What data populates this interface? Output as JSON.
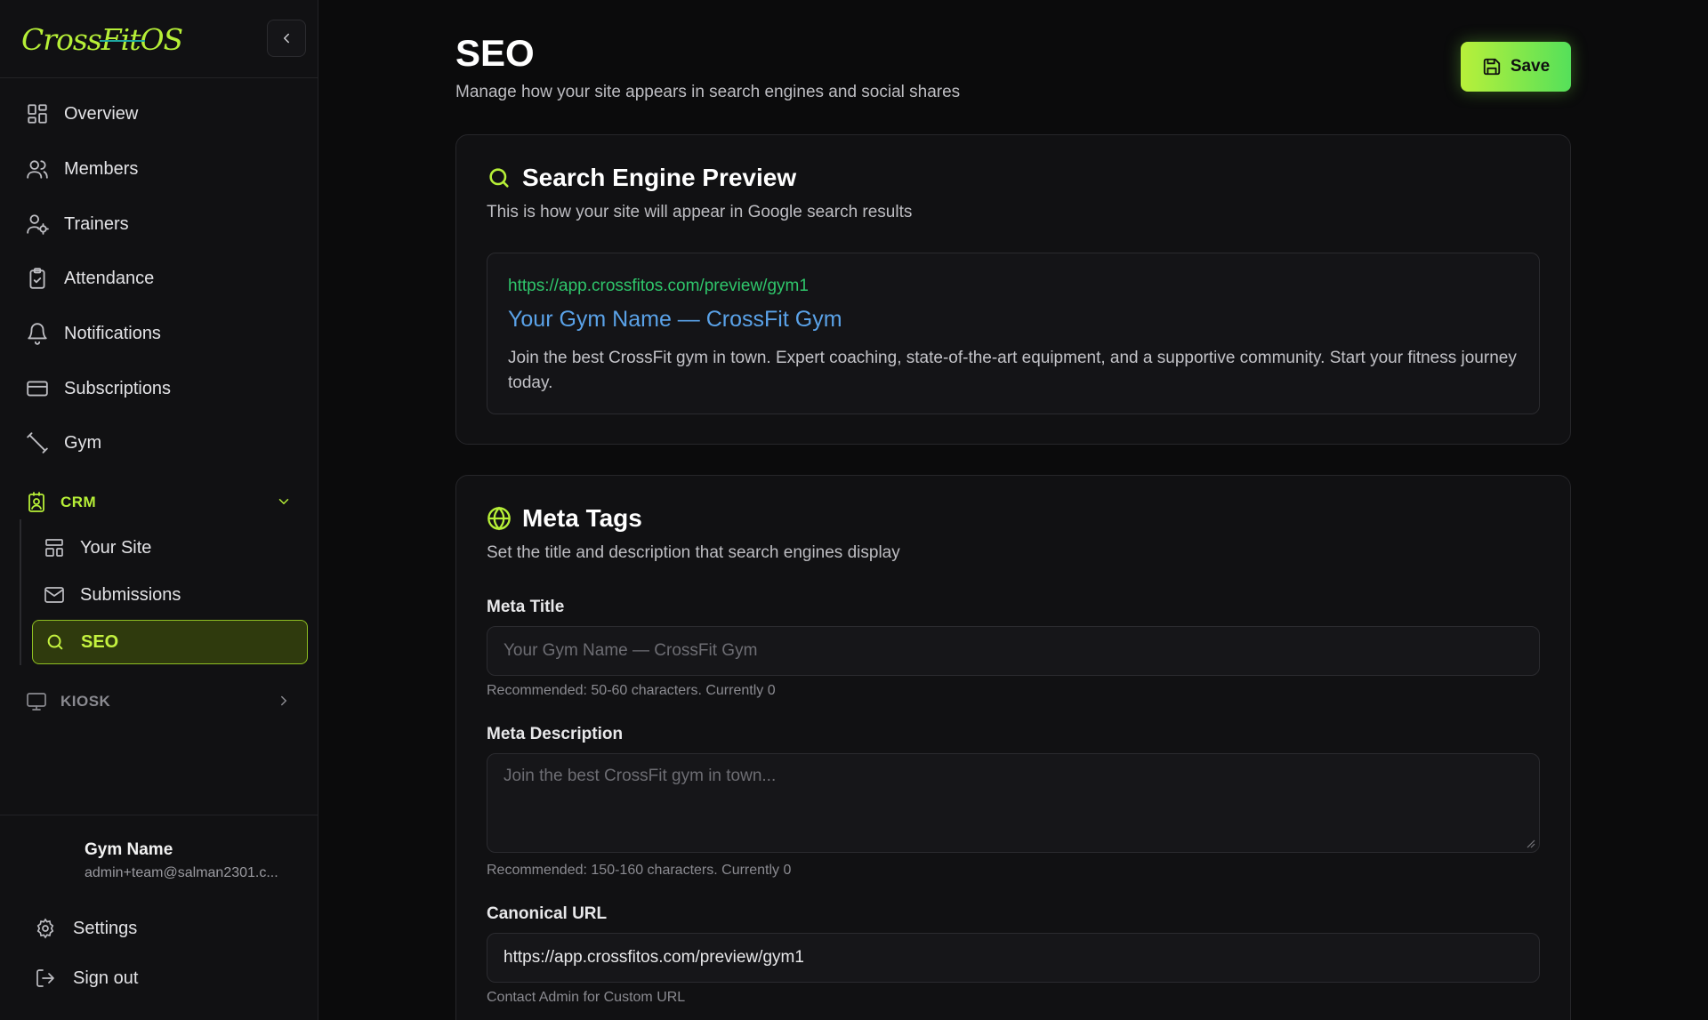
{
  "app": {
    "brand": {
      "prefix": "Cross",
      "strike": "Fit",
      "suffix": "OS"
    },
    "accent": "#b6ef37"
  },
  "sidebar": {
    "items": [
      {
        "label": "Overview",
        "icon": "grid-icon"
      },
      {
        "label": "Members",
        "icon": "users-icon"
      },
      {
        "label": "Trainers",
        "icon": "user-cog-icon"
      },
      {
        "label": "Attendance",
        "icon": "clipboard-check-icon"
      },
      {
        "label": "Notifications",
        "icon": "bell-icon"
      },
      {
        "label": "Subscriptions",
        "icon": "credit-card-icon"
      },
      {
        "label": "Gym",
        "icon": "dumbbell-icon"
      }
    ],
    "crm": {
      "label": "CRM",
      "icon": "contact-icon",
      "expanded": true,
      "items": [
        {
          "label": "Your Site",
          "icon": "layout-icon"
        },
        {
          "label": "Submissions",
          "icon": "mail-icon"
        },
        {
          "label": "SEO",
          "icon": "search-icon",
          "active": true
        }
      ]
    },
    "kiosk": {
      "label": "KIOSK",
      "icon": "monitor-icon",
      "expanded": false
    },
    "user": {
      "name": "Gym Name",
      "email": "admin+team@salman2301.c..."
    },
    "footer": {
      "settings": "Settings",
      "signout": "Sign out"
    }
  },
  "header": {
    "title": "SEO",
    "subtitle": "Manage how your site appears in search engines and social shares",
    "save_label": "Save"
  },
  "preview_card": {
    "title": "Search Engine Preview",
    "subtitle": "This is how your site will appear in Google search results",
    "url": "https://app.crossfitos.com/preview/gym1",
    "page_title": "Your Gym Name — CrossFit Gym",
    "description": "Join the best CrossFit gym in town. Expert coaching, state-of-the-art equipment, and a supportive community. Start your fitness journey today."
  },
  "meta_card": {
    "title": "Meta Tags",
    "subtitle": "Set the title and description that search engines display",
    "meta_title": {
      "label": "Meta Title",
      "placeholder": "Your Gym Name — CrossFit Gym",
      "value": "",
      "hint": "Recommended: 50-60 characters. Currently 0"
    },
    "meta_description": {
      "label": "Meta Description",
      "placeholder": "Join the best CrossFit gym in town...",
      "value": "",
      "hint": "Recommended: 150-160 characters. Currently 0"
    },
    "canonical": {
      "label": "Canonical URL",
      "value": "https://app.crossfitos.com/preview/gym1",
      "hint": "Contact Admin for Custom URL"
    }
  }
}
